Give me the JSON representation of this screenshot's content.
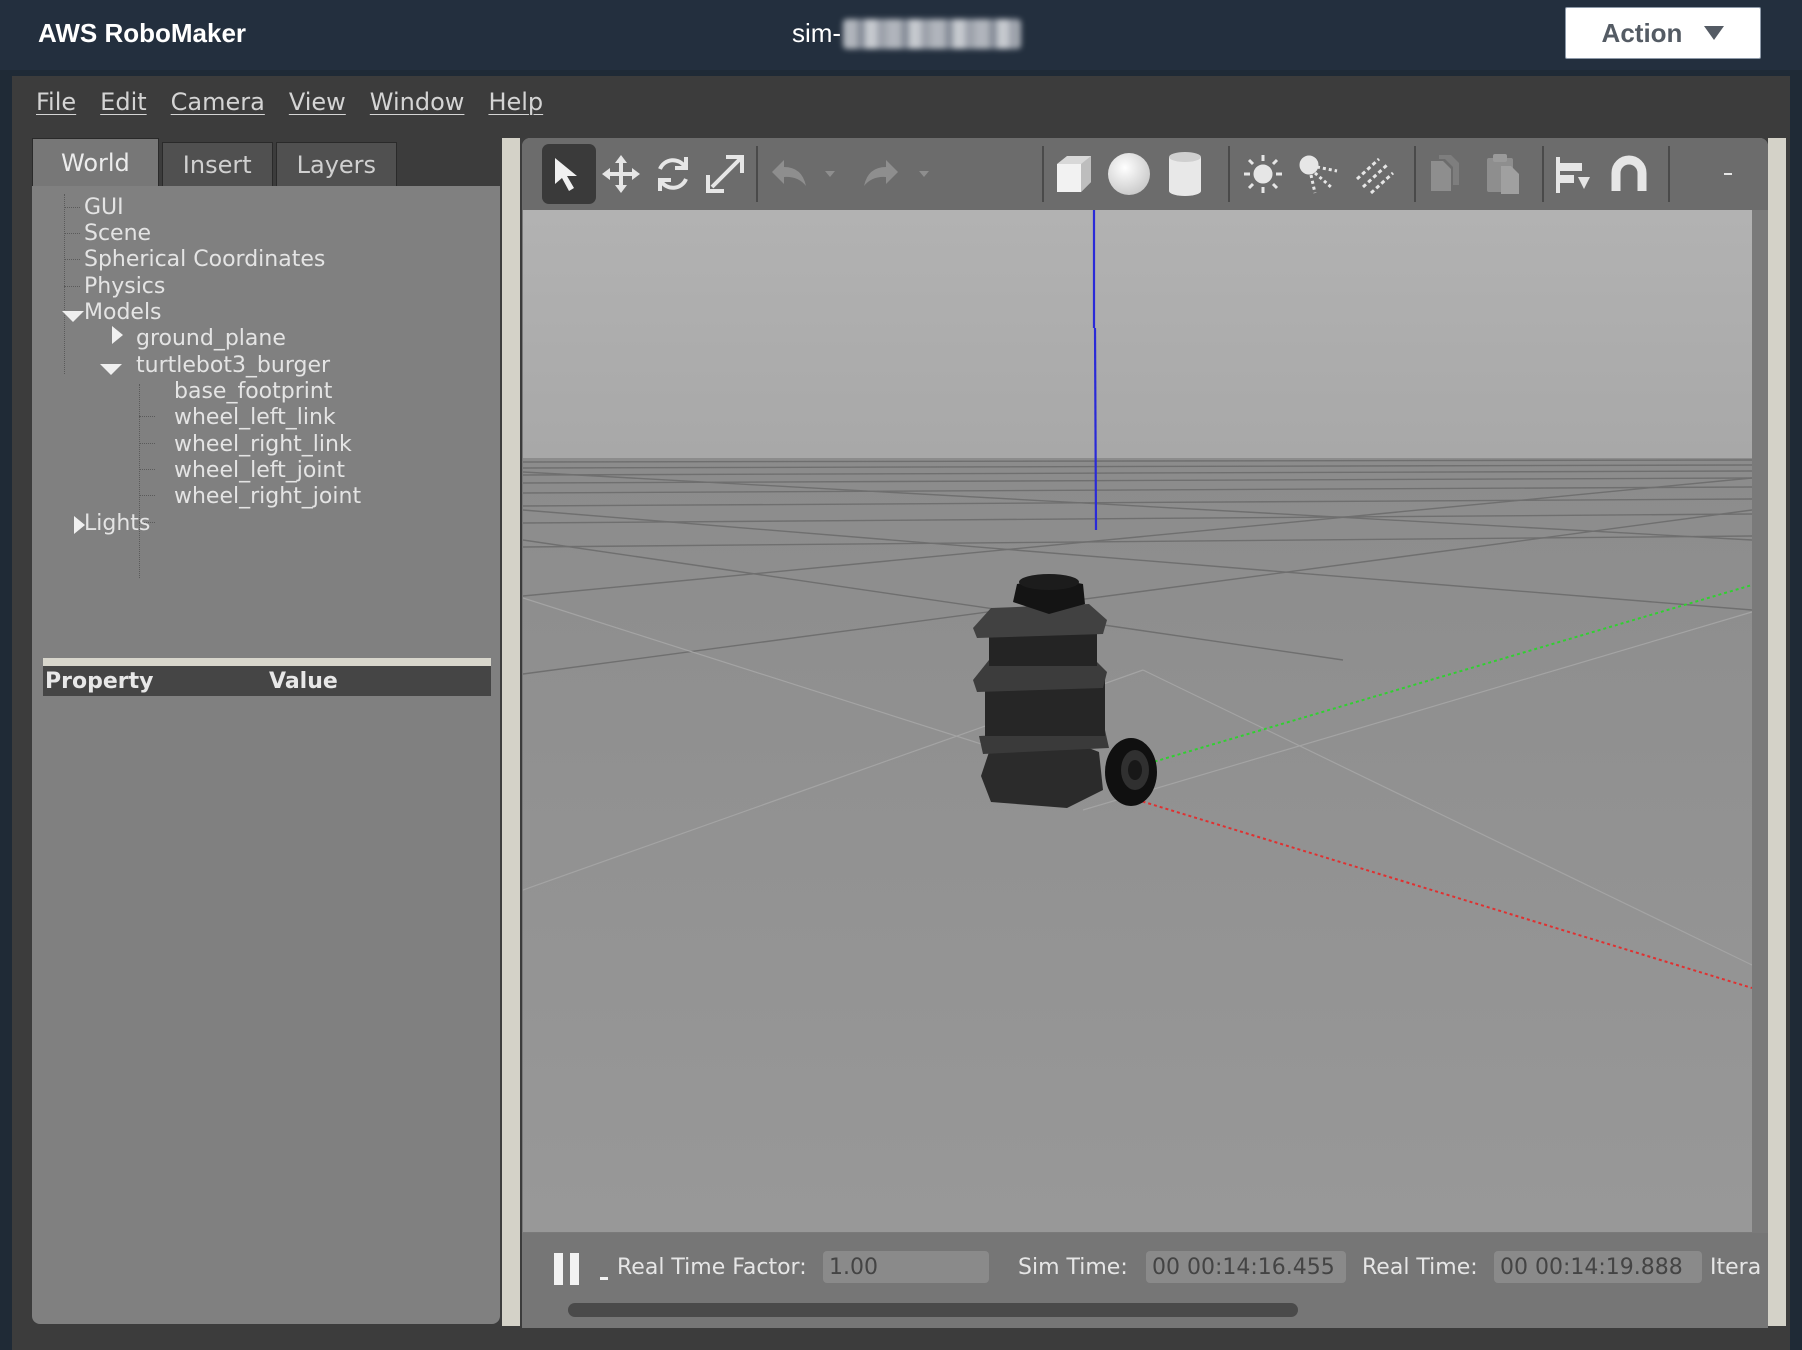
{
  "topbar": {
    "brand": "AWS RoboMaker",
    "sim_name_prefix": "sim-",
    "action_label": "Action"
  },
  "menu": [
    "File",
    "Edit",
    "Camera",
    "View",
    "Window",
    "Help"
  ],
  "tabs": [
    "World",
    "Insert",
    "Layers"
  ],
  "active_tab": "World",
  "tree": {
    "gui": "GUI",
    "scene": "Scene",
    "spherical": "Spherical Coordinates",
    "physics": "Physics",
    "models": "Models",
    "ground_plane": "ground_plane",
    "turtlebot": "turtlebot3_burger",
    "base_footprint": "base_footprint",
    "wheel_left_link": "wheel_left_link",
    "wheel_right_link": "wheel_right_link",
    "wheel_left_joint": "wheel_left_joint",
    "wheel_right_joint": "wheel_right_joint",
    "lights": "Lights"
  },
  "property_table": {
    "col_property": "Property",
    "col_value": "Value"
  },
  "toolbar_icons": [
    "select-arrow-icon",
    "translate-icon",
    "rotate-icon",
    "scale-icon",
    "undo-icon",
    "undo-dropdown-icon",
    "redo-icon",
    "redo-dropdown-icon",
    "box-shape-icon",
    "sphere-shape-icon",
    "cylinder-shape-icon",
    "point-light-icon",
    "spot-light-icon",
    "directional-light-icon",
    "copy-icon",
    "paste-icon",
    "align-icon",
    "snap-magnet-icon"
  ],
  "status": {
    "rtf_label": "Real Time Factor:",
    "rtf_value": "1.00",
    "sim_label": "Sim Time:",
    "sim_value": "00 00:14:16.455",
    "real_label": "Real Time:",
    "real_value": "00 00:14:19.888",
    "iter_label": "Itera"
  },
  "colors": {
    "aws_bar": "#232f3e",
    "panel_gray": "#808080",
    "axis_x": "#e03030",
    "axis_y": "#30d030",
    "axis_z": "#2a2ad8"
  }
}
